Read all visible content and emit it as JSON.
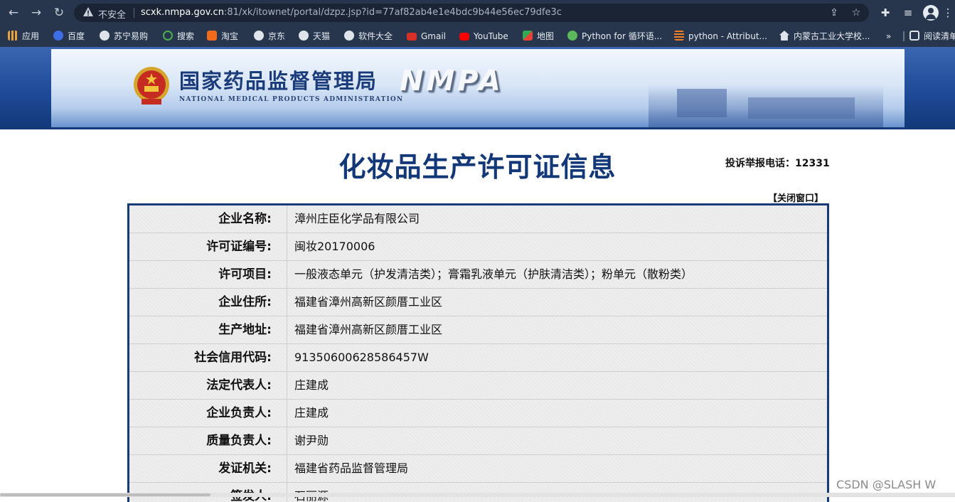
{
  "browser": {
    "security_label": "不安全",
    "url_host": "scxk.nmpa.gov.cn",
    "url_rest": ":81/xk/itownet/portal/dzpz.jsp?id=77af82ab4e1e4bdc9b44e56ec79dfe3c"
  },
  "bookmarks": [
    {
      "label": "应用",
      "icon_color": "#e8a33c"
    },
    {
      "label": "百度",
      "icon_color": "#3d6ee3"
    },
    {
      "label": "苏宁易购",
      "icon_color": "#dfe4ea"
    },
    {
      "label": "搜索",
      "icon_color": "#4caf50"
    },
    {
      "label": "淘宝",
      "icon_color": "#f26b1d"
    },
    {
      "label": "京东",
      "icon_color": "#dfe4ea"
    },
    {
      "label": "天猫",
      "icon_color": "#dfe4ea"
    },
    {
      "label": "软件大全",
      "icon_color": "#dfe4ea"
    },
    {
      "label": "Gmail",
      "icon_color": "#d93025"
    },
    {
      "label": "YouTube",
      "icon_color": "#ff0000"
    },
    {
      "label": "地图",
      "icon_color": "#34a853"
    },
    {
      "label": "Python for 循环语...",
      "icon_color": "#5cb85c"
    },
    {
      "label": "python - Attribut...",
      "icon_color": "#f48024"
    },
    {
      "label": "内蒙古工业大学校...",
      "icon_color": "#dfe4ea"
    },
    {
      "label": "阅读清单",
      "icon_color": "#dfe4ea"
    }
  ],
  "banner": {
    "org_cn": "国家药品监督管理局",
    "org_en": "NATIONAL MEDICAL PRODUCTS ADMINISTRATION",
    "abbr": "NMPA"
  },
  "page": {
    "title": "化妆品生产许可证信息",
    "hotline": "投诉举报电话：12331",
    "close_link": "【关闭窗口】"
  },
  "rows": [
    {
      "label": "企业名称:",
      "value": "漳州庄臣化学品有限公司"
    },
    {
      "label": "许可证编号:",
      "value": "闽妆20170006"
    },
    {
      "label": "许可项目:",
      "value": "一般液态单元（护发清洁类）；膏霜乳液单元（护肤清洁类）；粉单元（散粉类）"
    },
    {
      "label": "企业住所:",
      "value": "福建省漳州高新区颜厝工业区"
    },
    {
      "label": "生产地址:",
      "value": "福建省漳州高新区颜厝工业区"
    },
    {
      "label": "社会信用代码:",
      "value": "91350600628586457W"
    },
    {
      "label": "法定代表人:",
      "value": "庄建成"
    },
    {
      "label": "企业负责人:",
      "value": "庄建成"
    },
    {
      "label": "质量负责人:",
      "value": "谢尹勋"
    },
    {
      "label": "发证机关:",
      "value": "福建省药品监督管理局"
    },
    {
      "label": "签发人:",
      "value": "石丽源"
    }
  ],
  "watermark": "CSDN @SLASH W"
}
